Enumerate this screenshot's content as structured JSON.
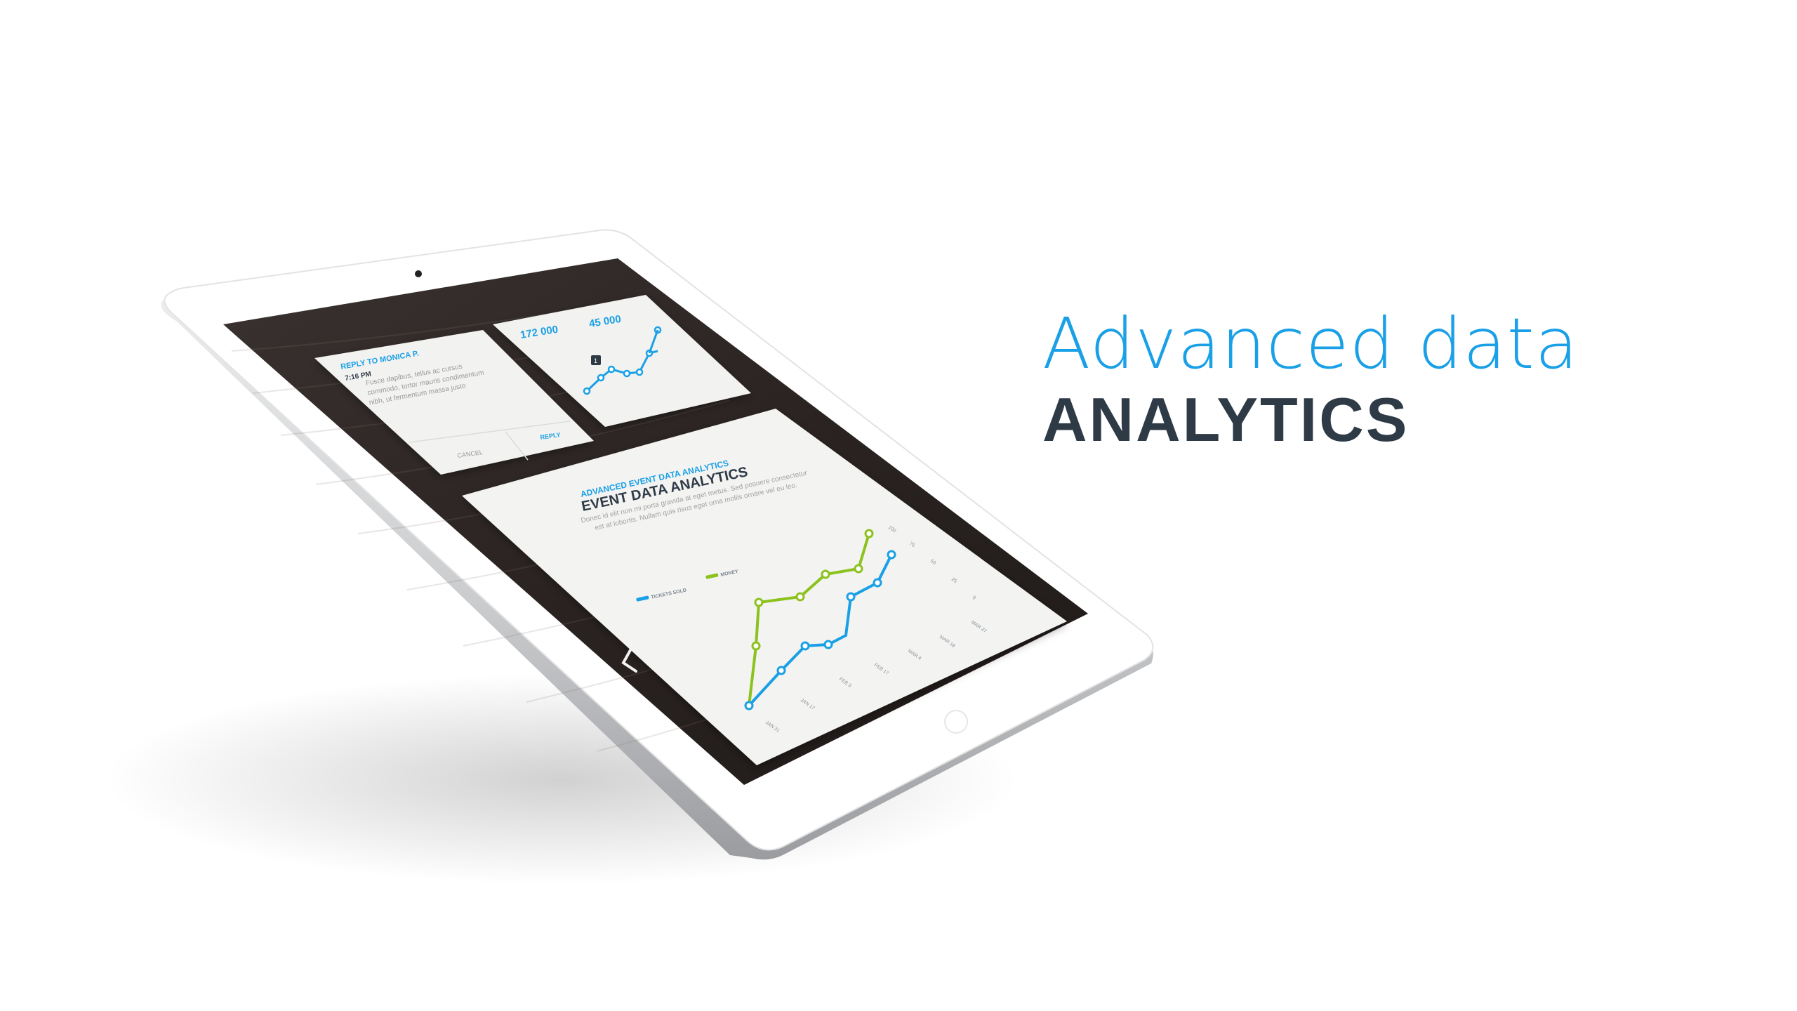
{
  "headline": {
    "line1": "Advanced data",
    "line2": "ANALYTICS"
  },
  "colors": {
    "accent": "#1aa0e6",
    "dark": "#2f3a47",
    "green": "#8cc21e",
    "wood": "#2b2523"
  },
  "tablet": {
    "top_bar": [
      "",
      "",
      ""
    ],
    "message_card": {
      "title": "REPLY TO MONICA P.",
      "time": "7:16 PM",
      "body": "Fusce dapibus, tellus ac cursus commodo, tortor mauris condimentum nibh, ut fermentum massa justo",
      "cancel_label": "CANCEL",
      "reply_label": "REPLY"
    },
    "stats_card": {
      "stat1_value": "172 000",
      "stat1_label": "",
      "stat2_value": "45 000",
      "stat2_label": "",
      "badge": "1",
      "icon": "map-pin-icon"
    },
    "analytics_card": {
      "kicker": "ADVANCED EVENT DATA ANALYTICS",
      "title": "EVENT DATA ANALYTICS",
      "body": "Donec id elit non mi porta gravida at eget metus. Sed posuere consectetur est at lobortis. Nullam quis risus eget urna mollis ornare vel eu leo.",
      "legend": [
        {
          "label": "TICKETS SOLD",
          "color": "#1aa0e6"
        },
        {
          "label": "MONEY",
          "color": "#8cc21e"
        }
      ],
      "x_labels": [
        "JAN 31",
        "JAN 17",
        "FEB 3",
        "FEB 17",
        "MAR 4",
        "MAR 18",
        "MAR 27"
      ],
      "y_labels": [
        "100",
        "75",
        "50",
        "25",
        "0"
      ],
      "prev_icon": "chevron-left-icon",
      "next_icon": "chevron-right-icon"
    }
  }
}
